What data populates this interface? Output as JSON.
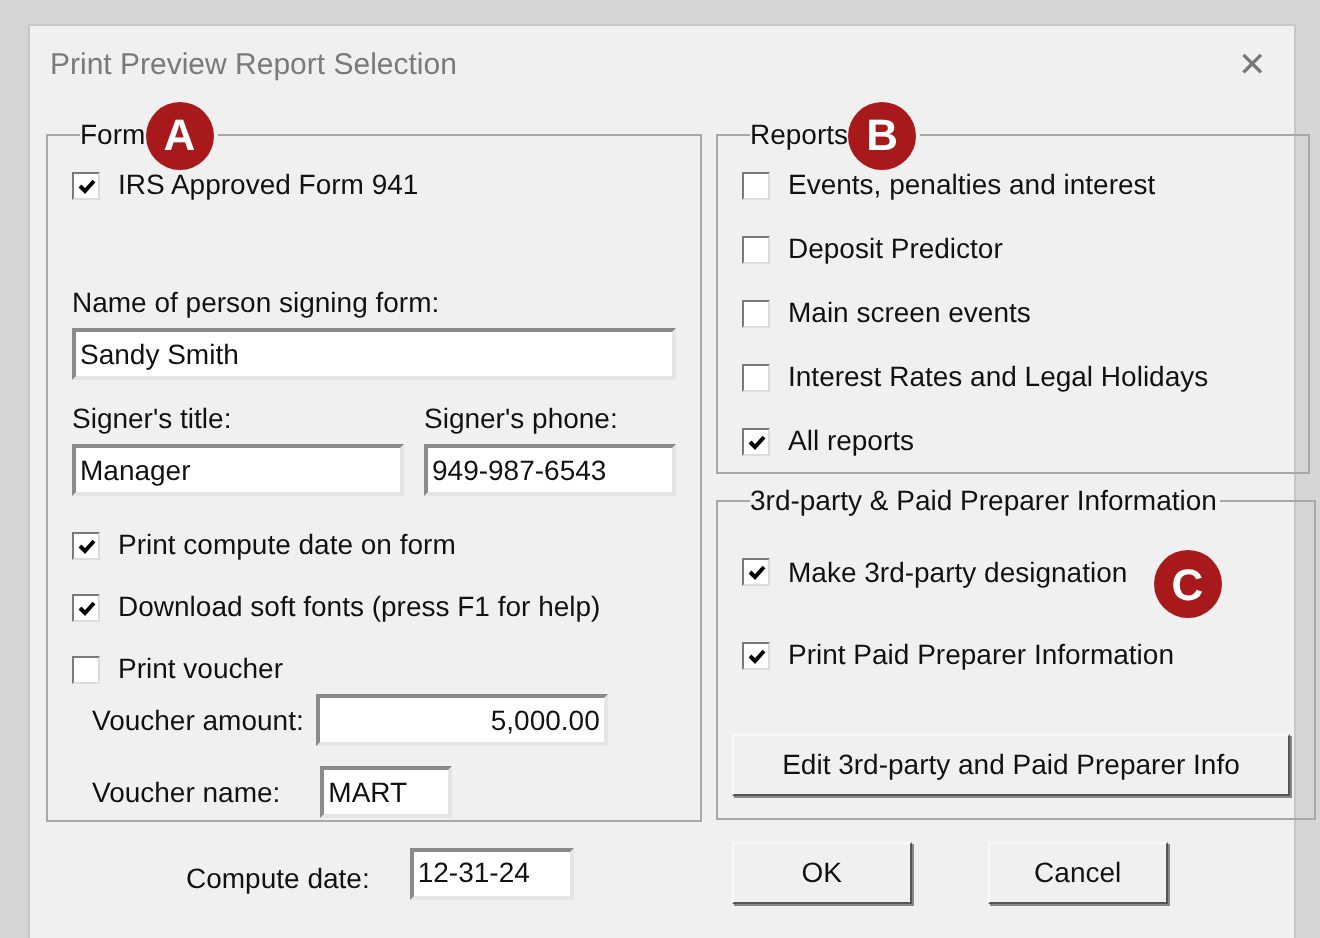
{
  "window": {
    "title": "Print Preview Report Selection",
    "close": "✕"
  },
  "form_group": {
    "title": "Form",
    "callout": "A",
    "approved": {
      "label": "IRS Approved Form 941",
      "checked": true
    },
    "signer_name": {
      "label": "Name of person signing form:",
      "value": "Sandy Smith"
    },
    "signer_title": {
      "label": "Signer's title:",
      "value": "Manager"
    },
    "signer_phone": {
      "label": "Signer's phone:",
      "value": "949-987-6543"
    },
    "options": [
      {
        "label": "Print compute date on form",
        "checked": true
      },
      {
        "label": "Download soft fonts (press F1 for help)",
        "checked": true
      },
      {
        "label": "Print voucher",
        "checked": false
      }
    ],
    "voucher_amount": {
      "label": "Voucher amount:",
      "value": "5,000.00"
    },
    "voucher_name": {
      "label": "Voucher name:",
      "value": "MART"
    }
  },
  "reports_group": {
    "title": "Reports",
    "callout": "B",
    "items": [
      {
        "label": "Events, penalties and interest",
        "checked": false
      },
      {
        "label": "Deposit Predictor",
        "checked": false
      },
      {
        "label": "Main screen events",
        "checked": false
      },
      {
        "label": "Interest Rates and Legal Holidays",
        "checked": false
      },
      {
        "label": "All reports",
        "checked": true
      }
    ]
  },
  "preparer_group": {
    "title": "3rd-party & Paid Preparer Information",
    "callout": "C",
    "items": [
      {
        "label": "Make 3rd-party designation",
        "checked": true
      },
      {
        "label": "Print Paid Preparer Information",
        "checked": true
      }
    ],
    "button": "Edit 3rd-party and Paid Preparer Info"
  },
  "compute_date": {
    "label": "Compute date:",
    "value": "12-31-24"
  },
  "buttons": [
    "OK",
    "Cancel"
  ]
}
